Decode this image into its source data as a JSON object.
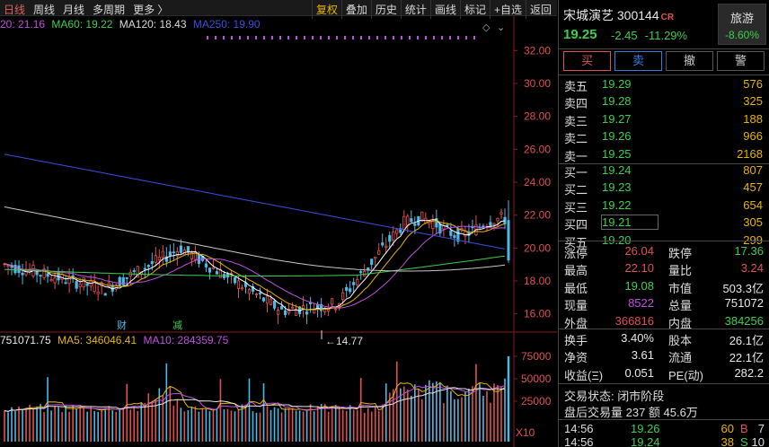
{
  "tabs": [
    "日线",
    "周线",
    "月线",
    "多周期",
    "更多 〉"
  ],
  "tools": [
    "复权",
    "叠加",
    "历史",
    "统计",
    "画线",
    "标记",
    "+自选",
    "返回"
  ],
  "ma": {
    "ma20": "20: 21.16",
    "ma60": "MA60: 19.22",
    "ma120": "MA120: 18.43",
    "ma250": "MA250: 19.90"
  },
  "price_axis": [
    "32.00",
    "30.00",
    "28.00",
    "26.00",
    "24.00",
    "22.00",
    "20.00",
    "18.00",
    "16.00"
  ],
  "low_mark": "14.77",
  "markers": {
    "cai": "财",
    "jian": "减"
  },
  "vol": {
    "vol": "751071.75",
    "ma5": "MA5: 346046.41",
    "ma10": "MA10: 284359.75"
  },
  "vol_axis": [
    "75000",
    "50000",
    "25000",
    "X10"
  ],
  "stock": {
    "name": "宋城演艺",
    "code": "300144",
    "tag": "CR",
    "price": "19.25",
    "change": "-2.45",
    "pct": "-11.29%"
  },
  "sector": {
    "name": "旅游",
    "pct": "-8.60%"
  },
  "buttons": [
    "买",
    "卖",
    "撤",
    "警"
  ],
  "asks": [
    {
      "label": "卖五",
      "price": "19.29",
      "qty": "576"
    },
    {
      "label": "卖四",
      "price": "19.28",
      "qty": "325"
    },
    {
      "label": "卖三",
      "price": "19.27",
      "qty": "188"
    },
    {
      "label": "卖二",
      "price": "19.26",
      "qty": "966"
    },
    {
      "label": "卖一",
      "price": "19.25",
      "qty": "2168"
    }
  ],
  "bids": [
    {
      "label": "买一",
      "price": "19.24",
      "qty": "807"
    },
    {
      "label": "买二",
      "price": "19.23",
      "qty": "457"
    },
    {
      "label": "买三",
      "price": "19.22",
      "qty": "654"
    },
    {
      "label": "买四",
      "price": "19.21",
      "qty": "305"
    },
    {
      "label": "买五",
      "price": "19.20",
      "qty": "299"
    }
  ],
  "stats1": [
    {
      "k1": "涨停",
      "v1": "26.04",
      "c1": "red",
      "k2": "跌停",
      "v2": "17.36",
      "c2": "green"
    },
    {
      "k1": "最高",
      "v1": "22.10",
      "c1": "red",
      "k2": "量比",
      "v2": "3.24",
      "c2": "red"
    },
    {
      "k1": "最低",
      "v1": "19.08",
      "c1": "green",
      "k2": "市值",
      "v2": "503.3亿",
      "c2": "white"
    },
    {
      "k1": "现量",
      "v1": "8522",
      "c1": "purple",
      "k2": "总量",
      "v2": "751072",
      "c2": "white"
    },
    {
      "k1": "外盘",
      "v1": "366816",
      "c1": "red",
      "k2": "内盘",
      "v2": "384256",
      "c2": "green"
    }
  ],
  "stats2": [
    {
      "k1": "换手",
      "v1": "3.40%",
      "c1": "white",
      "k2": "股本",
      "v2": "26.1亿",
      "c2": "white"
    },
    {
      "k1": "净资",
      "v1": "3.61",
      "c1": "white",
      "k2": "流通",
      "v2": "22.1亿",
      "c2": "white"
    },
    {
      "k1": "收益(Ξ)",
      "v1": "0.051",
      "c1": "white",
      "k2": "PE(动)",
      "v2": "282.2",
      "c2": "white"
    }
  ],
  "status": {
    "state": "交易状态: 闭市阶段",
    "after": "盘后交易量 237 额 45.6万"
  },
  "trades": [
    {
      "time": "14:56",
      "price": "19.26",
      "qty": "60",
      "dir": "B",
      "cnt": "7"
    },
    {
      "time": "14:56",
      "price": "19.24",
      "qty": "38",
      "dir": "S",
      "cnt": "10"
    }
  ],
  "colors": {
    "up": "#e05050",
    "down": "#3ccf4e",
    "ma5": "#ffffff",
    "ma10": "#e8b400",
    "ma20": "#c050e0",
    "ma60": "#3ccf4e",
    "ma250": "#3a4ee0",
    "ma120": "#c8c8c8"
  }
}
